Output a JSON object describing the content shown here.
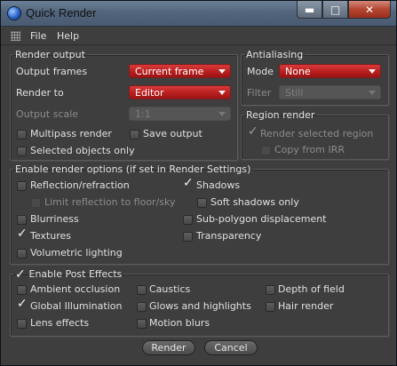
{
  "window": {
    "title": "Quick Render",
    "minimize": "▬",
    "maximize": "□",
    "close": "✕"
  },
  "menu": {
    "file": "File",
    "help": "Help"
  },
  "render_output": {
    "legend": "Render output",
    "output_frames_label": "Output frames",
    "output_frames_value": "Current frame",
    "render_to_label": "Render to",
    "render_to_value": "Editor",
    "output_scale_label": "Output scale",
    "output_scale_value": "1:1",
    "multipass": "Multipass render",
    "save_output": "Save output",
    "selected_only": "Selected objects only"
  },
  "antialiasing": {
    "legend": "Antialiasing",
    "mode_label": "Mode",
    "mode_value": "None",
    "filter_label": "Filter",
    "filter_value": "Still"
  },
  "region": {
    "legend": "Region render",
    "render_selected": "Render selected region",
    "copy_irr": "Copy from IRR"
  },
  "options": {
    "legend": "Enable render options (if set in Render Settings)",
    "reflection": "Reflection/refraction",
    "limit_reflection": "Limit reflection to floor/sky",
    "blurriness": "Blurriness",
    "textures": "Textures",
    "volumetric": "Volumetric lighting",
    "shadows": "Shadows",
    "soft_shadows": "Soft shadows only",
    "subpolygon": "Sub-polygon displacement",
    "transparency": "Transparency"
  },
  "post": {
    "legend": "Enable Post Effects",
    "ambient": "Ambient occlusion",
    "gi": "Global Illumination",
    "lens": "Lens effects",
    "caustics": "Caustics",
    "glows": "Glows and highlights",
    "motion": "Motion blurs",
    "dof": "Depth of field",
    "hair": "Hair render"
  },
  "buttons": {
    "render": "Render",
    "cancel": "Cancel"
  }
}
